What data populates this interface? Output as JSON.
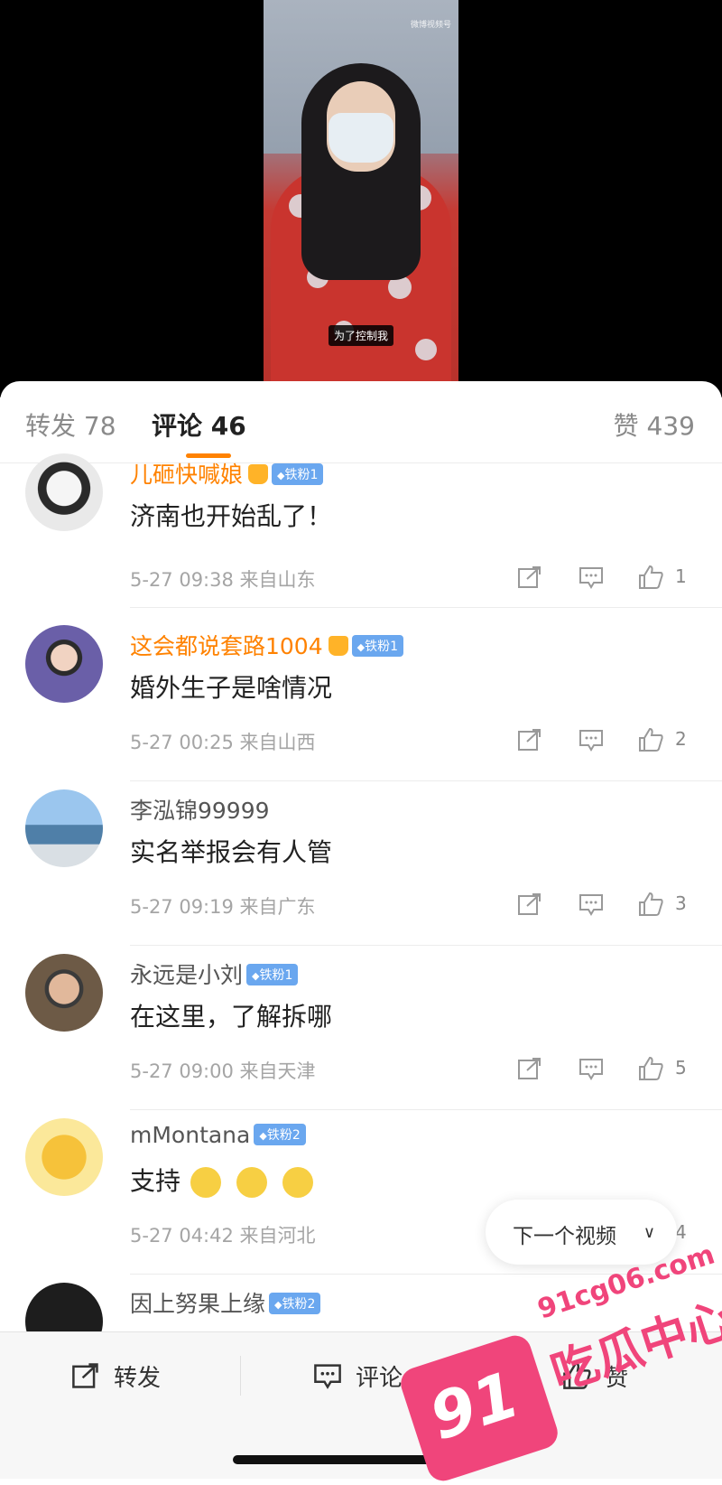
{
  "video": {
    "watermark": "微博视频号",
    "caption": "为了控制我"
  },
  "tabs": {
    "repost_label": "转发",
    "repost_count": "78",
    "comment_label": "评论",
    "comment_count": "46",
    "like_label": "赞",
    "like_count": "439"
  },
  "comments": [
    {
      "user": "儿砸快喊娘",
      "badge": "铁粉1",
      "vip": true,
      "text": "济南也开始乱了！",
      "meta": "5-27 09:38  来自山东",
      "likes": "1"
    },
    {
      "user": "这会都说套路1004",
      "badge": "铁粉1",
      "vip": true,
      "text": "婚外生子是啥情况",
      "meta": "5-27 00:25  来自山西",
      "likes": "2"
    },
    {
      "user": "李泓锦99999",
      "badge": "",
      "vip": false,
      "text": "实名举报会有人管",
      "meta": "5-27 09:19  来自广东",
      "likes": "3"
    },
    {
      "user": "永远是小刘",
      "badge": "铁粉1",
      "vip": false,
      "text": "在这里，了解拆哪",
      "meta": "5-27 09:00  来自天津",
      "likes": "5"
    },
    {
      "user": "mMontana",
      "badge": "铁粉2",
      "vip": false,
      "text": "支持",
      "meta": "5-27 04:42  来自河北",
      "likes": "4"
    },
    {
      "user": "因上努果上缘",
      "badge": "铁粉2",
      "vip": false,
      "text": "",
      "meta": "",
      "likes": ""
    }
  ],
  "next_video": {
    "label": "下一个视频",
    "icon": "double-chevron-down-icon"
  },
  "bottom_bar": {
    "repost": "转发",
    "comment": "评论",
    "like": "赞"
  },
  "watermark": {
    "number": "91",
    "text": "吃瓜中心",
    "url": "91cg06.com"
  },
  "colors": {
    "accent": "#ff8200",
    "vip_name": "#ff8200",
    "badge": "#6aa7ef",
    "watermark": "#f0457b"
  }
}
